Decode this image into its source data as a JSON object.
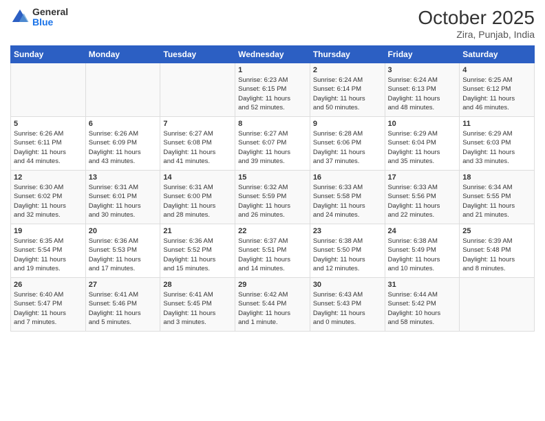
{
  "header": {
    "logo_general": "General",
    "logo_blue": "Blue",
    "month": "October 2025",
    "location": "Zira, Punjab, India"
  },
  "days_of_week": [
    "Sunday",
    "Monday",
    "Tuesday",
    "Wednesday",
    "Thursday",
    "Friday",
    "Saturday"
  ],
  "weeks": [
    [
      {
        "day": "",
        "info": ""
      },
      {
        "day": "",
        "info": ""
      },
      {
        "day": "",
        "info": ""
      },
      {
        "day": "1",
        "info": "Sunrise: 6:23 AM\nSunset: 6:15 PM\nDaylight: 11 hours\nand 52 minutes."
      },
      {
        "day": "2",
        "info": "Sunrise: 6:24 AM\nSunset: 6:14 PM\nDaylight: 11 hours\nand 50 minutes."
      },
      {
        "day": "3",
        "info": "Sunrise: 6:24 AM\nSunset: 6:13 PM\nDaylight: 11 hours\nand 48 minutes."
      },
      {
        "day": "4",
        "info": "Sunrise: 6:25 AM\nSunset: 6:12 PM\nDaylight: 11 hours\nand 46 minutes."
      }
    ],
    [
      {
        "day": "5",
        "info": "Sunrise: 6:26 AM\nSunset: 6:11 PM\nDaylight: 11 hours\nand 44 minutes."
      },
      {
        "day": "6",
        "info": "Sunrise: 6:26 AM\nSunset: 6:09 PM\nDaylight: 11 hours\nand 43 minutes."
      },
      {
        "day": "7",
        "info": "Sunrise: 6:27 AM\nSunset: 6:08 PM\nDaylight: 11 hours\nand 41 minutes."
      },
      {
        "day": "8",
        "info": "Sunrise: 6:27 AM\nSunset: 6:07 PM\nDaylight: 11 hours\nand 39 minutes."
      },
      {
        "day": "9",
        "info": "Sunrise: 6:28 AM\nSunset: 6:06 PM\nDaylight: 11 hours\nand 37 minutes."
      },
      {
        "day": "10",
        "info": "Sunrise: 6:29 AM\nSunset: 6:04 PM\nDaylight: 11 hours\nand 35 minutes."
      },
      {
        "day": "11",
        "info": "Sunrise: 6:29 AM\nSunset: 6:03 PM\nDaylight: 11 hours\nand 33 minutes."
      }
    ],
    [
      {
        "day": "12",
        "info": "Sunrise: 6:30 AM\nSunset: 6:02 PM\nDaylight: 11 hours\nand 32 minutes."
      },
      {
        "day": "13",
        "info": "Sunrise: 6:31 AM\nSunset: 6:01 PM\nDaylight: 11 hours\nand 30 minutes."
      },
      {
        "day": "14",
        "info": "Sunrise: 6:31 AM\nSunset: 6:00 PM\nDaylight: 11 hours\nand 28 minutes."
      },
      {
        "day": "15",
        "info": "Sunrise: 6:32 AM\nSunset: 5:59 PM\nDaylight: 11 hours\nand 26 minutes."
      },
      {
        "day": "16",
        "info": "Sunrise: 6:33 AM\nSunset: 5:58 PM\nDaylight: 11 hours\nand 24 minutes."
      },
      {
        "day": "17",
        "info": "Sunrise: 6:33 AM\nSunset: 5:56 PM\nDaylight: 11 hours\nand 22 minutes."
      },
      {
        "day": "18",
        "info": "Sunrise: 6:34 AM\nSunset: 5:55 PM\nDaylight: 11 hours\nand 21 minutes."
      }
    ],
    [
      {
        "day": "19",
        "info": "Sunrise: 6:35 AM\nSunset: 5:54 PM\nDaylight: 11 hours\nand 19 minutes."
      },
      {
        "day": "20",
        "info": "Sunrise: 6:36 AM\nSunset: 5:53 PM\nDaylight: 11 hours\nand 17 minutes."
      },
      {
        "day": "21",
        "info": "Sunrise: 6:36 AM\nSunset: 5:52 PM\nDaylight: 11 hours\nand 15 minutes."
      },
      {
        "day": "22",
        "info": "Sunrise: 6:37 AM\nSunset: 5:51 PM\nDaylight: 11 hours\nand 14 minutes."
      },
      {
        "day": "23",
        "info": "Sunrise: 6:38 AM\nSunset: 5:50 PM\nDaylight: 11 hours\nand 12 minutes."
      },
      {
        "day": "24",
        "info": "Sunrise: 6:38 AM\nSunset: 5:49 PM\nDaylight: 11 hours\nand 10 minutes."
      },
      {
        "day": "25",
        "info": "Sunrise: 6:39 AM\nSunset: 5:48 PM\nDaylight: 11 hours\nand 8 minutes."
      }
    ],
    [
      {
        "day": "26",
        "info": "Sunrise: 6:40 AM\nSunset: 5:47 PM\nDaylight: 11 hours\nand 7 minutes."
      },
      {
        "day": "27",
        "info": "Sunrise: 6:41 AM\nSunset: 5:46 PM\nDaylight: 11 hours\nand 5 minutes."
      },
      {
        "day": "28",
        "info": "Sunrise: 6:41 AM\nSunset: 5:45 PM\nDaylight: 11 hours\nand 3 minutes."
      },
      {
        "day": "29",
        "info": "Sunrise: 6:42 AM\nSunset: 5:44 PM\nDaylight: 11 hours\nand 1 minute."
      },
      {
        "day": "30",
        "info": "Sunrise: 6:43 AM\nSunset: 5:43 PM\nDaylight: 11 hours\nand 0 minutes."
      },
      {
        "day": "31",
        "info": "Sunrise: 6:44 AM\nSunset: 5:42 PM\nDaylight: 10 hours\nand 58 minutes."
      },
      {
        "day": "",
        "info": ""
      }
    ]
  ]
}
